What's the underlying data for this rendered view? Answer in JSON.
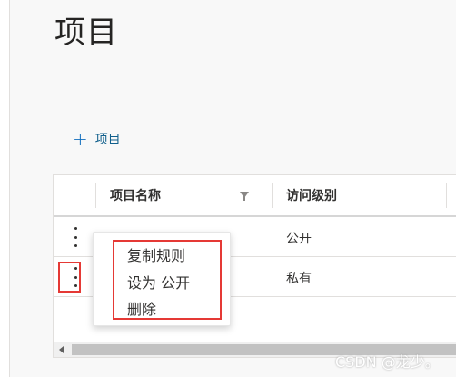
{
  "page": {
    "title": "项目"
  },
  "toolbar": {
    "add_label": "项目",
    "add_icon": "plus-icon"
  },
  "table": {
    "columns": [
      {
        "label": "项目名称",
        "icon": "filter-icon"
      },
      {
        "label": "访问级别"
      }
    ],
    "rows": [
      {
        "access": "公开",
        "action_icon": "more-vertical-icon"
      },
      {
        "access": "私有",
        "action_icon": "more-vertical-icon"
      }
    ]
  },
  "context_menu": {
    "items": [
      {
        "label": "复制规则"
      },
      {
        "label": "设为 公开"
      },
      {
        "label": "删除"
      }
    ]
  },
  "watermark": "CSDN @龙少。",
  "colors": {
    "accent": "#0f6cbd",
    "highlight": "#e53935"
  }
}
